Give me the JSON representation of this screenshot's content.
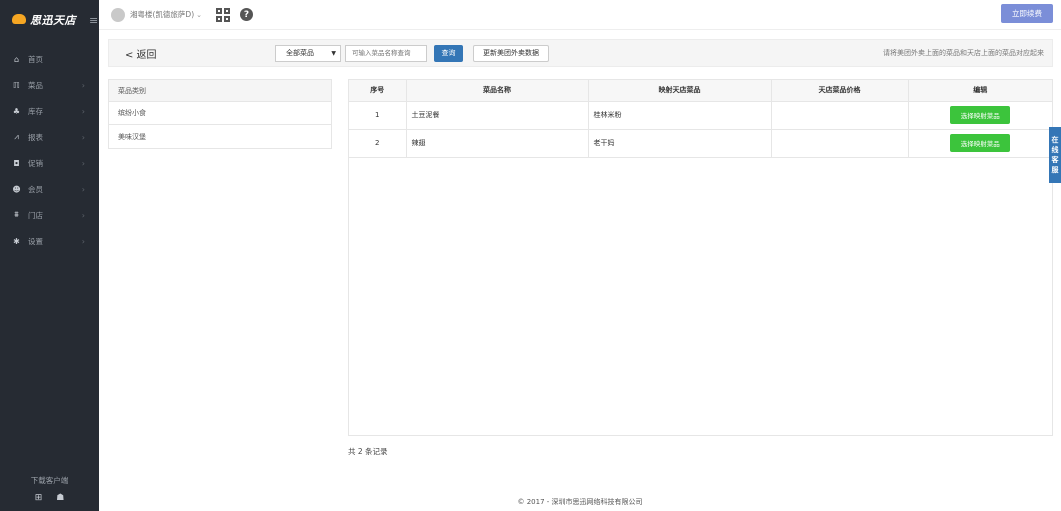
{
  "app": {
    "logo_text": "思迅天店",
    "menu_toggle_icon": "hamburger-icon"
  },
  "sidebar": {
    "items": [
      {
        "icon": "home-icon",
        "glyph": "⌂",
        "label": "首页",
        "has_arrow": false
      },
      {
        "icon": "fork-knife-icon",
        "glyph": "ℿ",
        "label": "菜品",
        "has_arrow": true
      },
      {
        "icon": "inventory-icon",
        "glyph": "♣",
        "label": "库存",
        "has_arrow": true
      },
      {
        "icon": "chart-line-icon",
        "glyph": "⩘",
        "label": "报表",
        "has_arrow": true
      },
      {
        "icon": "gift-icon",
        "glyph": "◘",
        "label": "促销",
        "has_arrow": true
      },
      {
        "icon": "members-icon",
        "glyph": "☻",
        "label": "会员",
        "has_arrow": true
      },
      {
        "icon": "bank-icon",
        "glyph": "⩩",
        "label": "门店",
        "has_arrow": true
      },
      {
        "icon": "gear-icon",
        "glyph": "✱",
        "label": "设置",
        "has_arrow": true
      }
    ],
    "download_label": "下载客户端"
  },
  "topbar": {
    "store_name": "湘粤楼(凯德旅萨D)",
    "renew_label": "立即续费"
  },
  "filter": {
    "back_label": "< 返回",
    "category_selected": "全部菜品",
    "search_placeholder": "可输入菜品名称查询",
    "query_label": "查询",
    "update_label": "更新美团外卖数据",
    "hint": "请将美团外卖上面的菜品和天店上面的菜品对应起来"
  },
  "categories": {
    "header": "菜品类别",
    "items": [
      "缤纷小食",
      "美味汉堡"
    ]
  },
  "table": {
    "columns": [
      "序号",
      "菜品名称",
      "映射天店菜品",
      "天店菜品价格",
      "编辑"
    ],
    "rows": [
      {
        "index": "1",
        "name": "土豆泥餐",
        "mapped": "桂林米粉",
        "price": "",
        "action": "选择映射菜品"
      },
      {
        "index": "2",
        "name": "辣翅",
        "mapped": "老干妈",
        "price": "",
        "action": "选择映射菜品"
      }
    ]
  },
  "record_count": "共 2 条记录",
  "footer": "© 2017 - 深圳市思迅网络科技有限公司",
  "service_tab": [
    "在",
    "线",
    "客",
    "服"
  ],
  "colors": {
    "sidebar_bg": "#262b33",
    "renew": "#7b8ed8",
    "query": "#3476b6",
    "map_btn": "#3cc43c"
  }
}
